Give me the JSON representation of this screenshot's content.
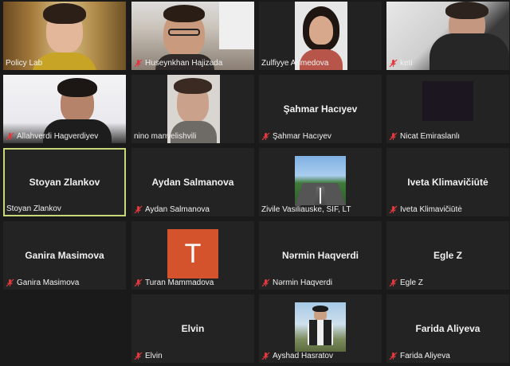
{
  "participants": [
    {
      "name": "Policy Lab",
      "muted": false,
      "video": true
    },
    {
      "name": "Huseynkhan Hajizada",
      "muted": true,
      "video": true
    },
    {
      "name": "Zulfiyye Ahmedova",
      "muted": false,
      "video": true
    },
    {
      "name": "keti",
      "muted": true,
      "video": true
    },
    {
      "name": "Allahverdi Hagverdiyev",
      "muted": true,
      "video": true
    },
    {
      "name": "nino manvelishvili",
      "muted": false,
      "video": true
    },
    {
      "name": "Şahmar Hacıyev",
      "muted": true,
      "video": false
    },
    {
      "name": "Nicat Emiraslanlı",
      "muted": true,
      "video": true
    },
    {
      "name": "Stoyan Zlankov",
      "muted": false,
      "video": false,
      "active_speaker": true
    },
    {
      "name": "Aydan Salmanova",
      "muted": true,
      "video": false
    },
    {
      "name": "Zivile Vasiliauske, SIF, LT",
      "muted": false,
      "video": false,
      "avatar": "road-photo"
    },
    {
      "name": "Iveta Klimavičiūtė",
      "muted": true,
      "video": false
    },
    {
      "name": "Ganira Masimova",
      "muted": true,
      "video": false
    },
    {
      "name": "Turan Mammadova",
      "muted": true,
      "video": false,
      "avatar": "letter",
      "avatar_letter": "T",
      "avatar_color": "#d4532d"
    },
    {
      "name": "Nərmin Haqverdi",
      "muted": true,
      "video": false
    },
    {
      "name": "Egle Z",
      "muted": true,
      "video": false
    },
    {
      "name": "Elvin",
      "muted": true,
      "video": false
    },
    {
      "name": "Ayshad Hasratov",
      "muted": true,
      "video": false,
      "avatar": "person-photo"
    },
    {
      "name": "Farida Aliyeva",
      "muted": true,
      "video": false
    }
  ],
  "colors": {
    "background": "#1a1a1a",
    "tile": "#232323",
    "active_border": "#c9d77a",
    "muted_icon": "#e0393e"
  }
}
